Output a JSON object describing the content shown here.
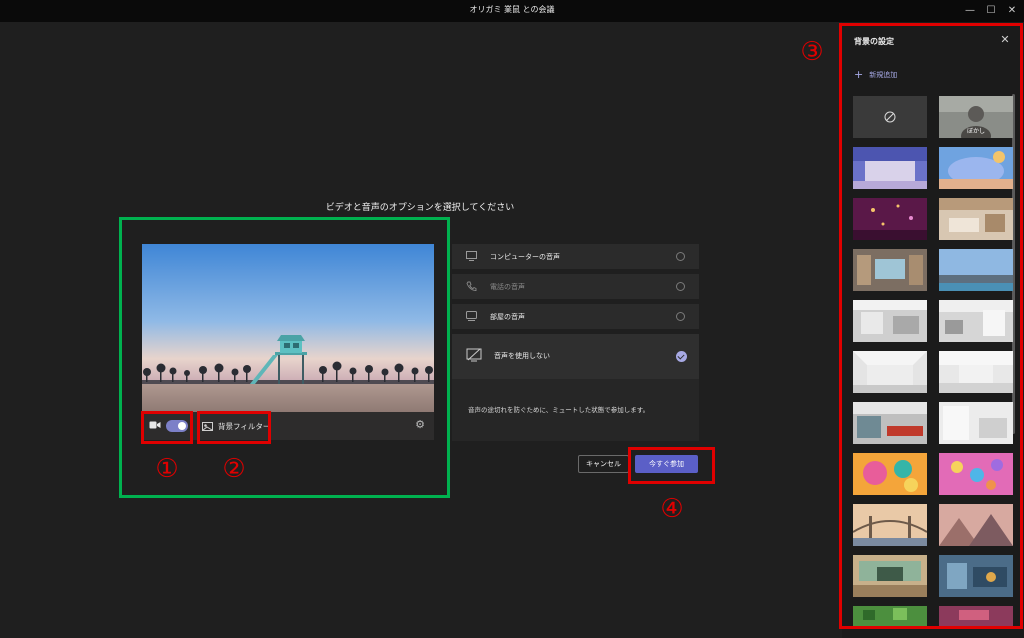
{
  "window": {
    "title": "オリガミ 業鼠 との会議",
    "minimize": "—",
    "maximize": "☐",
    "close": "✕"
  },
  "prejoin": {
    "heading": "ビデオと音声のオプションを選択してください",
    "video": {
      "camera_on": true,
      "background_filter_label": "背景フィルター",
      "settings_icon": "gear-icon"
    },
    "audio_options": [
      {
        "label": "コンピューターの音声",
        "icon": "monitor-icon",
        "selected": false,
        "enabled": true
      },
      {
        "label": "電話の音声",
        "icon": "phone-icon",
        "selected": false,
        "enabled": false
      },
      {
        "label": "部屋の音声",
        "icon": "room-icon",
        "selected": false,
        "enabled": true
      },
      {
        "label": "音声を使用しない",
        "icon": "audio-off-icon",
        "selected": true,
        "enabled": true
      }
    ],
    "audio_note": "音声の途切れを防ぐために、ミュートした状態で参加します。",
    "cancel_label": "キャンセル",
    "join_label": "今すぐ参加"
  },
  "background_panel": {
    "title": "背景の設定",
    "close": "✕",
    "add_new_label": "新規追加",
    "add_icon": "plus-icon",
    "blur_label": "ぼかし"
  },
  "annotations": [
    "①",
    "②",
    "③",
    "④"
  ],
  "colors": {
    "accent": "#5b5fc7",
    "annotation_red": "#e00000",
    "annotation_green": "#00b14f",
    "toggle_on": "#7c80c8"
  }
}
